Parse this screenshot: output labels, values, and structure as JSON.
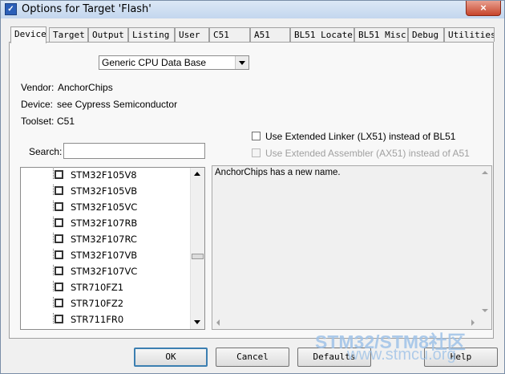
{
  "window": {
    "title": "Options for Target 'Flash'",
    "close_symbol": "×"
  },
  "tabs": [
    {
      "label": "Device",
      "active": true
    },
    {
      "label": "Target"
    },
    {
      "label": "Output"
    },
    {
      "label": "Listing"
    },
    {
      "label": "User"
    },
    {
      "label": "C51"
    },
    {
      "label": "A51"
    },
    {
      "label": "BL51 Locate"
    },
    {
      "label": "BL51 Misc"
    },
    {
      "label": "Debug"
    },
    {
      "label": "Utilities"
    }
  ],
  "device_db": {
    "selected": "Generic CPU Data Base"
  },
  "info": {
    "vendor_label": "Vendor:",
    "vendor_value": "AnchorChips",
    "device_label": "Device:",
    "device_value": "see Cypress Semiconductor",
    "toolset_label": "Toolset:",
    "toolset_value": "C51"
  },
  "options": {
    "lx51": {
      "label": "Use Extended Linker (LX51) instead of BL51",
      "checked": false,
      "enabled": true
    },
    "ax51": {
      "label": "Use Extended Assembler (AX51) instead of A51",
      "checked": false,
      "enabled": false
    }
  },
  "search": {
    "label": "Search:",
    "value": ""
  },
  "devices": [
    "STM32F105V8",
    "STM32F105VB",
    "STM32F105VC",
    "STM32F107RB",
    "STM32F107RC",
    "STM32F107VB",
    "STM32F107VC",
    "STR710FZ1",
    "STR710FZ2",
    "STR711FR0"
  ],
  "description": "AnchorChips has a new name.",
  "buttons": {
    "ok": "OK",
    "cancel": "Cancel",
    "defaults": "Defaults",
    "help": "Help"
  },
  "watermark": {
    "line1": "STM32/STM8社区",
    "line2": "www.stmcu.org"
  },
  "colors": {
    "accent": "#3c7fb1",
    "watermark": "#9fc3e8"
  }
}
